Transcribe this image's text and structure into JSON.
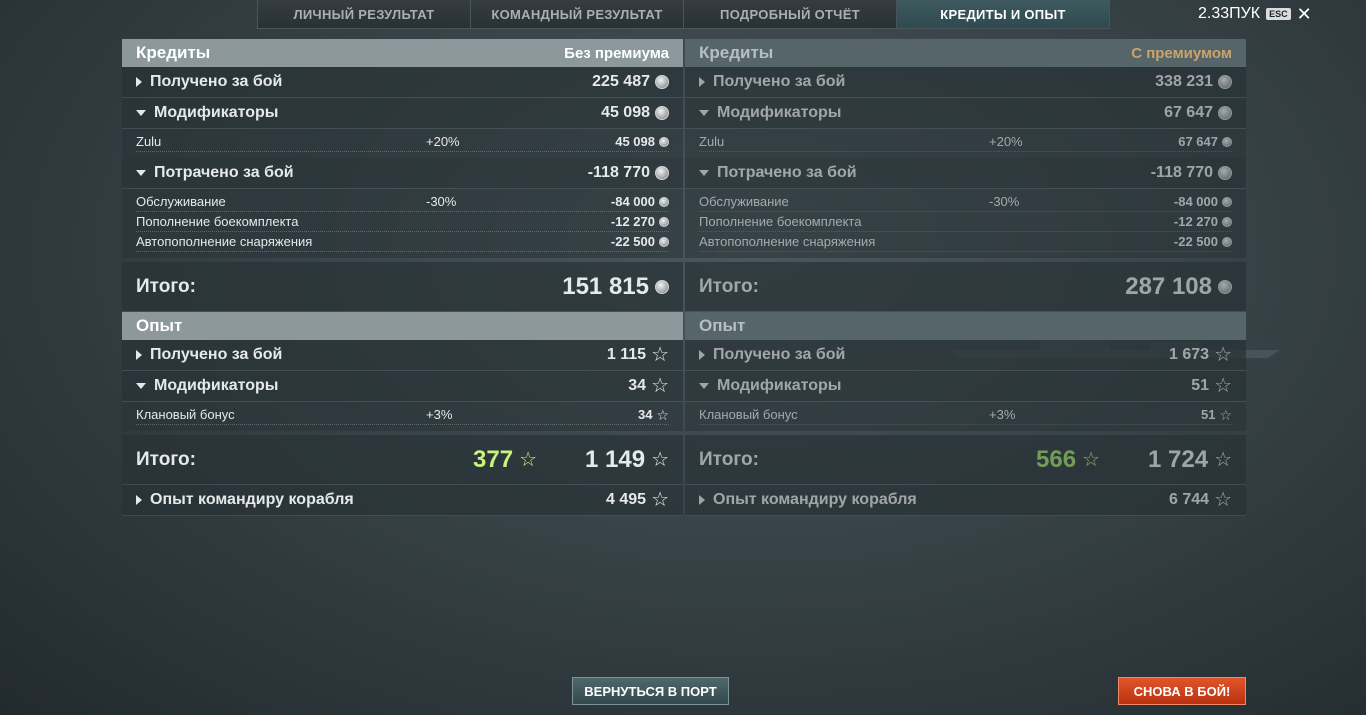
{
  "tabs": [
    {
      "label": "ЛИЧНЫЙ РЕЗУЛЬТАТ"
    },
    {
      "label": "КОМАНДНЫЙ РЕЗУЛЬТАТ"
    },
    {
      "label": "ПОДРОБНЫЙ ОТЧЁТ"
    },
    {
      "label": "КРЕДИТЫ И ОПЫТ"
    }
  ],
  "active_tab": "КРЕДИТЫ И ОПЫТ",
  "version": "2.33ПУК",
  "esc_label": "ESC",
  "close_symbol": "✕",
  "colors": {
    "accent": "#c7f27f",
    "premium": "#c9a46a",
    "battle_button": "#d4461e"
  },
  "left": {
    "credits": {
      "title": "Кредиты",
      "mode": "Без премиума",
      "earned": {
        "label": "Получено за бой",
        "value": "225 487"
      },
      "modifiers": {
        "label": "Модификаторы",
        "value": "45 098"
      },
      "modifier_rows": [
        {
          "name": "Zulu",
          "pct": "+20%",
          "value": "45 098"
        }
      ],
      "spent": {
        "label": "Потрачено за бой",
        "value": "-118 770"
      },
      "spent_rows": [
        {
          "name": "Обслуживание",
          "pct": "-30%",
          "value": "-84 000"
        },
        {
          "name": "Пополнение боекомплекта",
          "pct": "",
          "value": "-12 270"
        },
        {
          "name": "Автопополнение снаряжения",
          "pct": "",
          "value": "-22 500"
        }
      ],
      "total": {
        "label": "Итого:",
        "value": "151 815"
      }
    },
    "xp": {
      "title": "Опыт",
      "earned": {
        "label": "Получено за бой",
        "value": "1 115"
      },
      "modifiers": {
        "label": "Модификаторы",
        "value": "34"
      },
      "modifier_rows": [
        {
          "name": "Клановый бонус",
          "pct": "+3%",
          "value": "34"
        }
      ],
      "total": {
        "label": "Итого:",
        "bonus": "377",
        "value": "1 149"
      },
      "commander": {
        "label": "Опыт командиру корабля",
        "value": "4 495"
      }
    }
  },
  "right": {
    "credits": {
      "title": "Кредиты",
      "mode": "С премиумом",
      "earned": {
        "label": "Получено за бой",
        "value": "338 231"
      },
      "modifiers": {
        "label": "Модификаторы",
        "value": "67 647"
      },
      "modifier_rows": [
        {
          "name": "Zulu",
          "pct": "+20%",
          "value": "67 647"
        }
      ],
      "spent": {
        "label": "Потрачено за бой",
        "value": "-118 770"
      },
      "spent_rows": [
        {
          "name": "Обслуживание",
          "pct": "-30%",
          "value": "-84 000"
        },
        {
          "name": "Пополнение боекомплекта",
          "pct": "",
          "value": "-12 270"
        },
        {
          "name": "Автопополнение снаряжения",
          "pct": "",
          "value": "-22 500"
        }
      ],
      "total": {
        "label": "Итого:",
        "value": "287 108"
      }
    },
    "xp": {
      "title": "Опыт",
      "earned": {
        "label": "Получено за бой",
        "value": "1 673"
      },
      "modifiers": {
        "label": "Модификаторы",
        "value": "51"
      },
      "modifier_rows": [
        {
          "name": "Клановый бонус",
          "pct": "+3%",
          "value": "51"
        }
      ],
      "total": {
        "label": "Итого:",
        "bonus": "566",
        "value": "1 724"
      },
      "commander": {
        "label": "Опыт командиру корабля",
        "value": "6 744"
      }
    }
  },
  "buttons": {
    "port": "ВЕРНУТЬСЯ В ПОРТ",
    "battle": "СНОВА В БОЙ!"
  }
}
